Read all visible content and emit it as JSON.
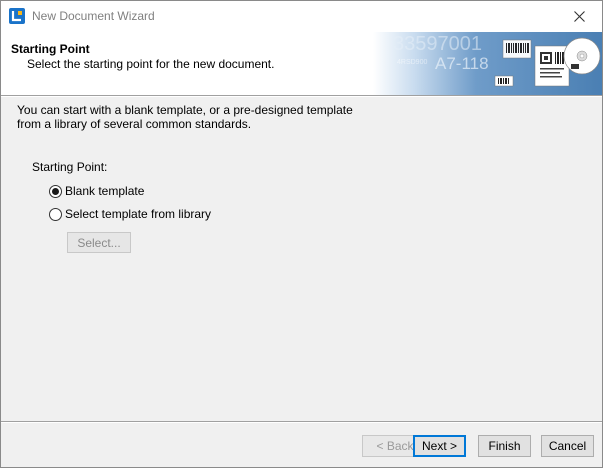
{
  "window": {
    "title": "New Document Wizard"
  },
  "header": {
    "title": "Starting Point",
    "subtitle": "Select the starting point for the new document.",
    "banner_text": {
      "big_number": "33597001",
      "code": "A7-118",
      "small": "4RSD900"
    }
  },
  "body": {
    "intro_line1": "You can start with a blank template, or a pre-designed template",
    "intro_line2": "from a library of several common standards.",
    "starting_point_label": "Starting Point:",
    "options": [
      {
        "label": "Blank template",
        "selected": true
      },
      {
        "label": "Select template from library",
        "selected": false
      }
    ],
    "select_button": "Select..."
  },
  "footer": {
    "back": "< Back",
    "next": "Next >",
    "finish": "Finish",
    "cancel": "Cancel"
  },
  "colors": {
    "accent": "#0078d7",
    "banner_blue": "#5b8fbf"
  },
  "icons": {
    "app": "app-logo-icon",
    "close": "close-icon"
  }
}
